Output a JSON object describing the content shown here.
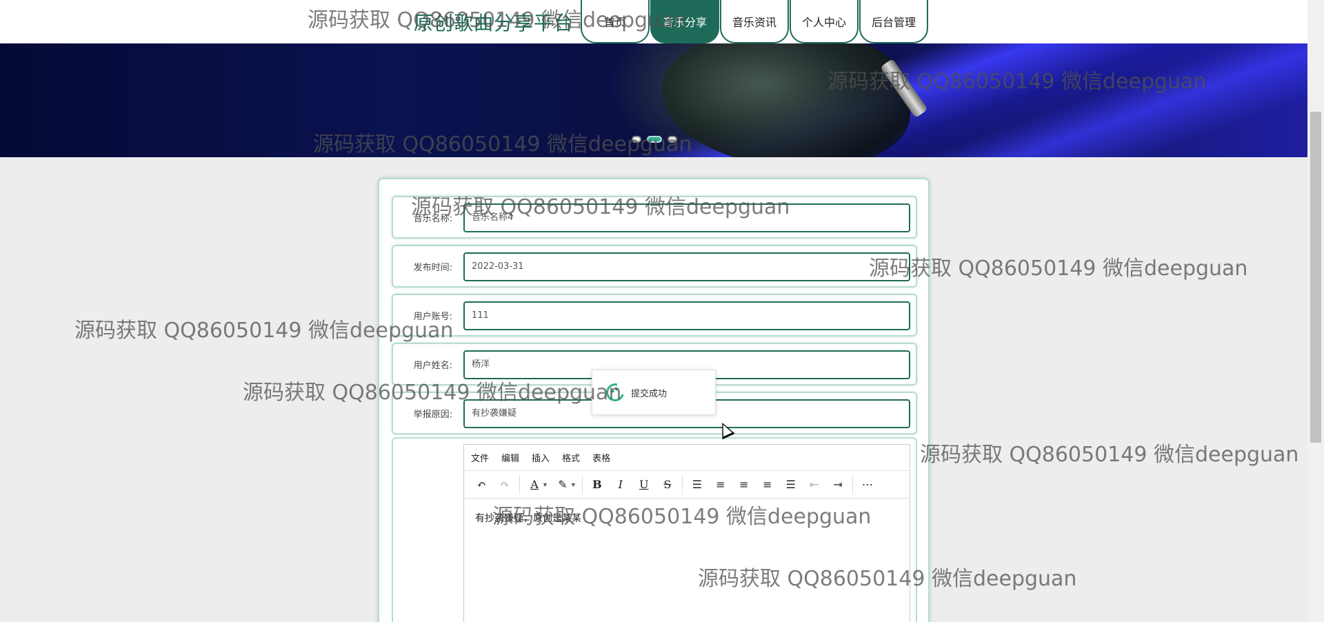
{
  "header": {
    "site_title": "原创歌曲分享平台",
    "nav": [
      {
        "label": "首页"
      },
      {
        "label": "音乐分享",
        "active": true
      },
      {
        "label": "音乐资讯"
      },
      {
        "label": "个人中心"
      },
      {
        "label": "后台管理"
      }
    ]
  },
  "banner": {
    "slide_count": 3,
    "active_slide": 2
  },
  "form": {
    "fields": [
      {
        "label": "音乐名称:",
        "value": "音乐名称4"
      },
      {
        "label": "发布时间:",
        "value": "2022-03-31"
      },
      {
        "label": "用户账号:",
        "value": "111"
      },
      {
        "label": "用户姓名:",
        "value": "杨洋"
      },
      {
        "label": "举报原因:",
        "value": "有抄袭嫌疑"
      }
    ],
    "editor": {
      "menu": [
        "文件",
        "编辑",
        "插入",
        "格式",
        "表格"
      ],
      "content": "有抄袭嫌疑，原创是某某"
    }
  },
  "toast": {
    "message": "提交成功"
  },
  "watermark": {
    "text": "源码获取 QQ86050149 微信deepguan"
  },
  "colors": {
    "brand": "#1d6b58",
    "success": "#2fb38a"
  }
}
